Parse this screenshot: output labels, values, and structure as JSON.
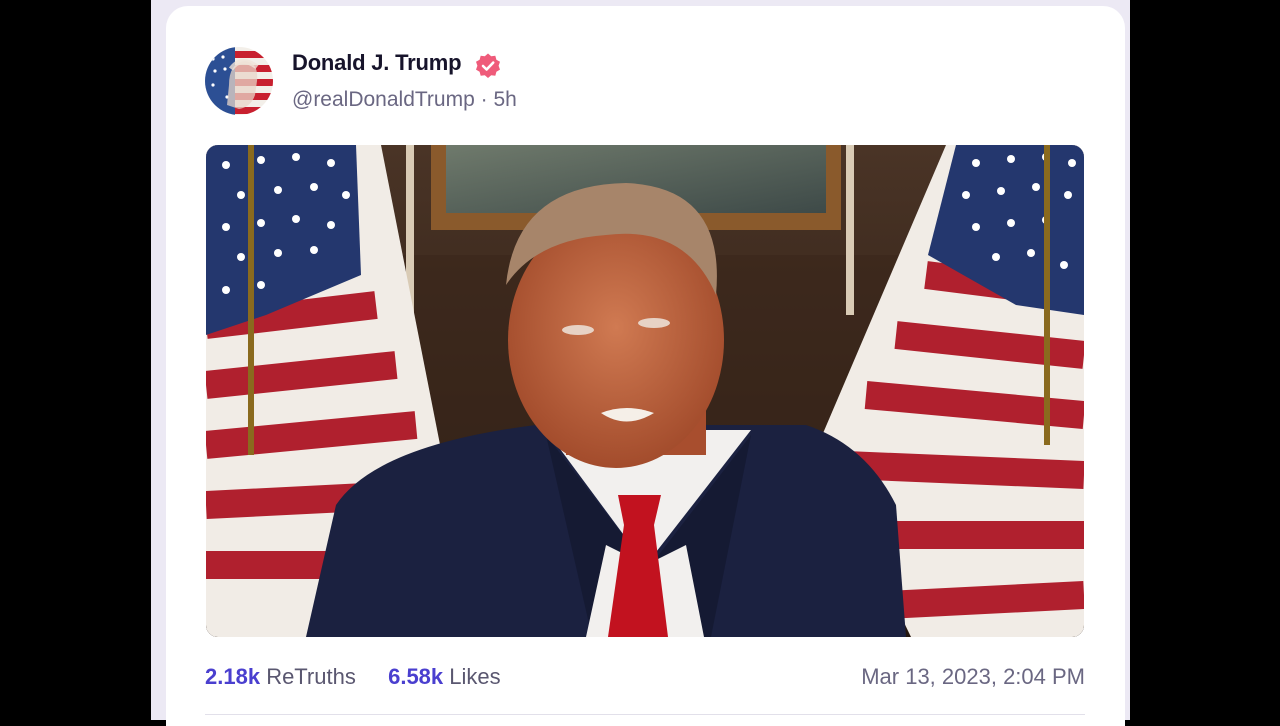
{
  "post": {
    "author_name": "Donald J. Trump",
    "handle": "@realDonaldTrump",
    "separator": "·",
    "age": "5h",
    "retruths_count": "2.18k",
    "retruths_label": "ReTruths",
    "likes_count": "6.58k",
    "likes_label": "Likes",
    "timestamp": "Mar 13, 2023, 2:04 PM"
  },
  "icons": {
    "verified": "verified-badge-icon"
  },
  "colors": {
    "accent": "#4a3fcf",
    "verified_badge": "#ef5b7a",
    "card": "#ffffff",
    "page_background": "#ece9f4"
  }
}
